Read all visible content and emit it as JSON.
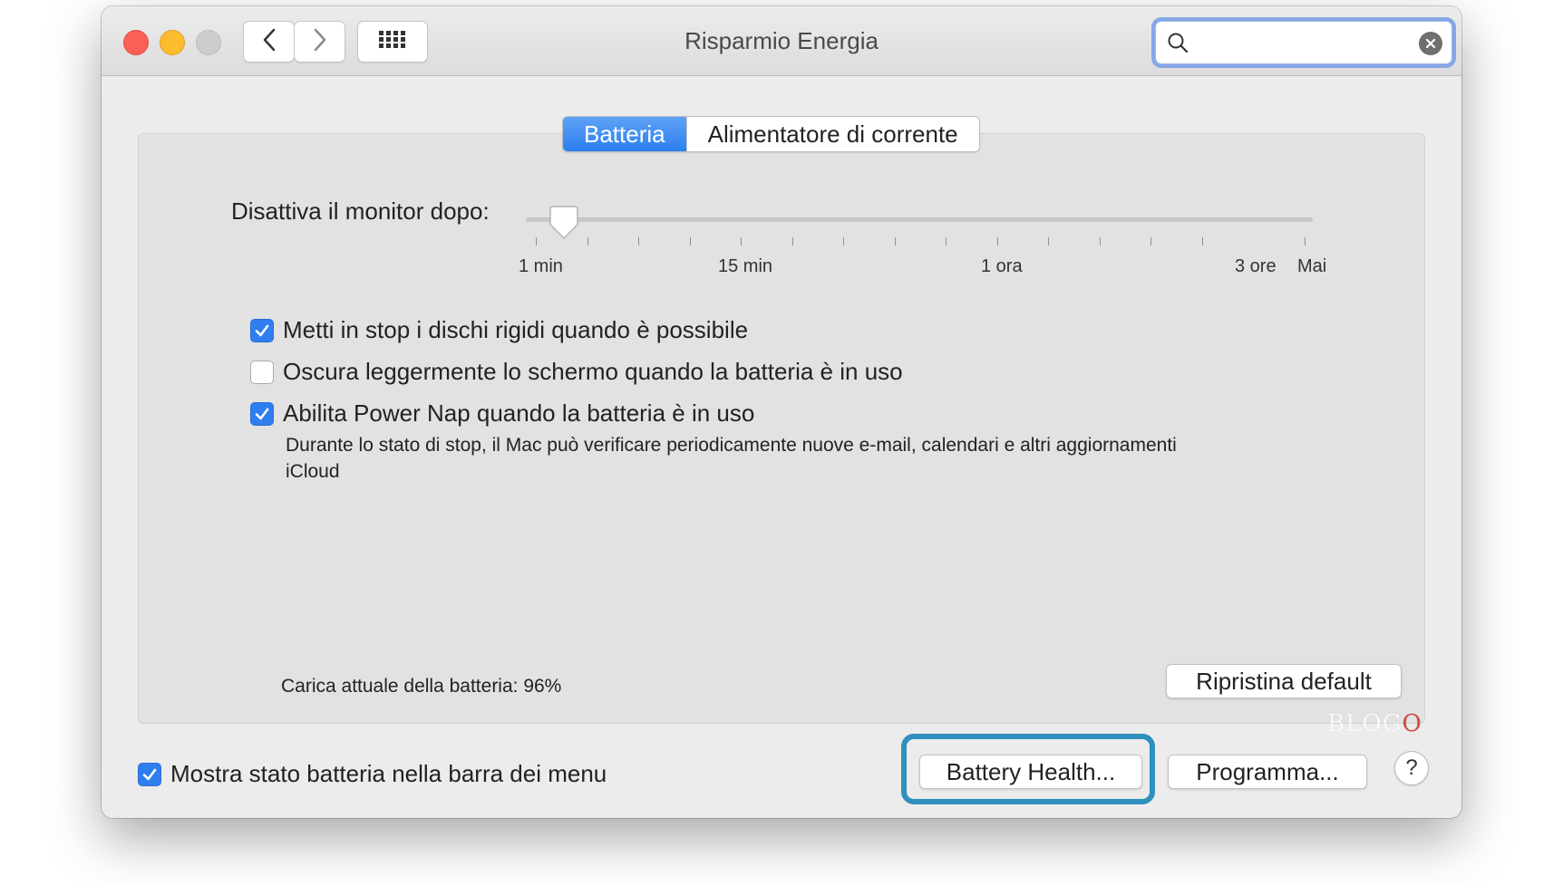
{
  "window": {
    "title": "Risparmio Energia"
  },
  "toolbar": {
    "back_icon": "chevron-left-icon",
    "forward_icon": "chevron-right-icon",
    "grid_icon": "grid-icon"
  },
  "search": {
    "value": "",
    "placeholder": "",
    "icon": "search-icon",
    "clear_icon": "clear-icon"
  },
  "tabs": [
    {
      "label": "Batteria",
      "active": true
    },
    {
      "label": "Alimentatore di corrente",
      "active": false
    }
  ],
  "display_sleep": {
    "label": "Disattiva il monitor dopo:",
    "value": "2 min",
    "tick_labels": [
      "1 min",
      "15 min",
      "1 ora",
      "3 ore",
      "Mai"
    ]
  },
  "options": [
    {
      "label": "Metti in stop i dischi rigidi quando è possibile",
      "checked": true
    },
    {
      "label": "Oscura leggermente lo schermo quando la batteria è in uso",
      "checked": false
    },
    {
      "label": "Abilita Power Nap quando la batteria è in uso",
      "checked": true
    }
  ],
  "power_nap_description": "Durante lo stato di stop, il Mac può verificare periodicamente nuove e-mail, calendari e altri aggiornamenti iCloud",
  "battery_charge": "Carica attuale della batteria: 96%",
  "buttons": {
    "reset": "Ripristina default",
    "battery_health": "Battery Health...",
    "schedule": "Programma...",
    "help": "?"
  },
  "show_battery_status": {
    "label": "Mostra stato batteria nella barra dei menu",
    "checked": true
  },
  "watermark": {
    "text": "BLOG",
    "accent": "O"
  },
  "colors": {
    "accent": "#2f7ef0",
    "highlight": "#2f90bd",
    "close": "#fc5f57",
    "minimize": "#fdbc2e"
  }
}
